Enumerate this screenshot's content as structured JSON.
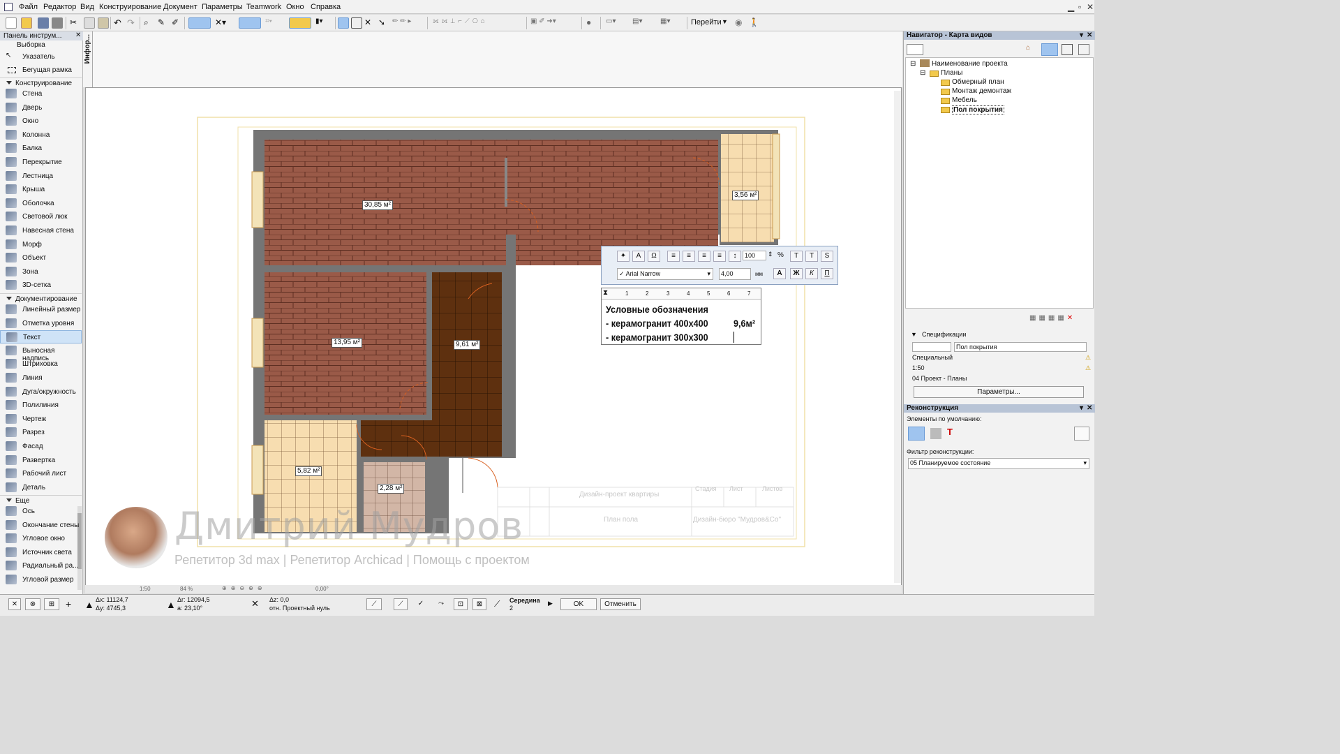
{
  "menu": {
    "items": [
      "Файл",
      "Редактор",
      "Вид",
      "Конструирование",
      "Документ",
      "Параметры",
      "Teamwork",
      "Окно",
      "Справка"
    ]
  },
  "toolbar": {
    "goto_label": "Перейти"
  },
  "toolbox": {
    "title": "Панель инструм...",
    "selection_label": "Выборка",
    "items_top": [
      "Указатель",
      "Бегущая рамка"
    ],
    "section_construct": "Конструирование",
    "construct_items": [
      "Стена",
      "Дверь",
      "Окно",
      "Колонна",
      "Балка",
      "Перекрытие",
      "Лестница",
      "Крыша",
      "Оболочка",
      "Световой люк",
      "Навесная стена",
      "Морф",
      "Объект",
      "Зона",
      "3D-сетка"
    ],
    "section_doc": "Документирование",
    "doc_items": [
      "Линейный размер",
      "Отметка уровня",
      "Текст",
      "Выносная надпись",
      "Штриховка",
      "Линия",
      "Дуга/окружность",
      "Полилиния",
      "Чертеж",
      "Разрез",
      "Фасад",
      "Развертка",
      "Рабочий лист",
      "Деталь"
    ],
    "section_more": "Еще",
    "more_items": [
      "Ось",
      "Окончание стены",
      "Угловое окно",
      "Источник света",
      "Радиальный ра...",
      "Угловой размер"
    ],
    "selected": "Текст",
    "info_tab": "Инфор..."
  },
  "navigator": {
    "title": "Навигатор - Карта видов",
    "root": "Наименование проекта",
    "plans": "Планы",
    "views": [
      "Обмерный план",
      "Монтаж демонтаж",
      "Мебель",
      "Пол покрытия"
    ],
    "selected_view": "Пол покрытия",
    "spec_title": "Спецификации",
    "spec_name": "Пол покрытия",
    "spec_layer": "Специальный",
    "spec_scale": "1:50",
    "spec_set": "04 Проект - Планы",
    "params_button": "Параметры..."
  },
  "reconstruction": {
    "title": "Реконструкция",
    "defaults_label": "Элементы по умолчанию:",
    "filter_label": "Фильтр реконструкции:",
    "filter_value": "05 Планируемое состояние"
  },
  "text_editor": {
    "size_value": "100",
    "percent": "%",
    "font": "Arial Narrow",
    "height_value": "4,00",
    "unit": "мм",
    "ruler_ticks": [
      "1",
      "2",
      "3",
      "4",
      "5",
      "6",
      "7"
    ],
    "lines": [
      "Условные обозначения",
      "- керамогранит 400х400",
      "- керамогранит 300х300"
    ],
    "value_text": "9,6м²"
  },
  "plan": {
    "areas": [
      "30,85 м²",
      "3,56 м²",
      "13,95 м²",
      "9,61 м²",
      "5,82 м²",
      "2,28 м²"
    ],
    "stamp_project": "Дизайн-проект квартиры",
    "stamp_sheet": "План пола",
    "stamp_bureau": "Дизайн-бюро \"Мудров&Co\"",
    "stamp_cols": [
      "Стадия",
      "Лист",
      "Листов"
    ]
  },
  "watermark": {
    "name": "Дмитрий Мудров",
    "subtitle": "Репетитор 3d max | Репетитор Archicad | Помощь с проектом"
  },
  "zoombar": {
    "scale": "1:50",
    "zoom": "84 %",
    "angle": "0,00°"
  },
  "status": {
    "dx": "Δx: 11124,7",
    "dy": "Δy: 4745,3",
    "dr": "Δr: 12094,5",
    "da": "a: 23,10°",
    "dz": "Δz: 0,0",
    "zero": "отн. Проектный нуль",
    "snap": "Середина",
    "snap_num": "2",
    "ok": "OK",
    "cancel": "Отменить"
  },
  "colors": {
    "brick": "#9a5a48",
    "dark_tile": "#5e300f",
    "light_tile": "#f7ddb0",
    "wall": "#757575",
    "selection": "#9fc4ef"
  }
}
